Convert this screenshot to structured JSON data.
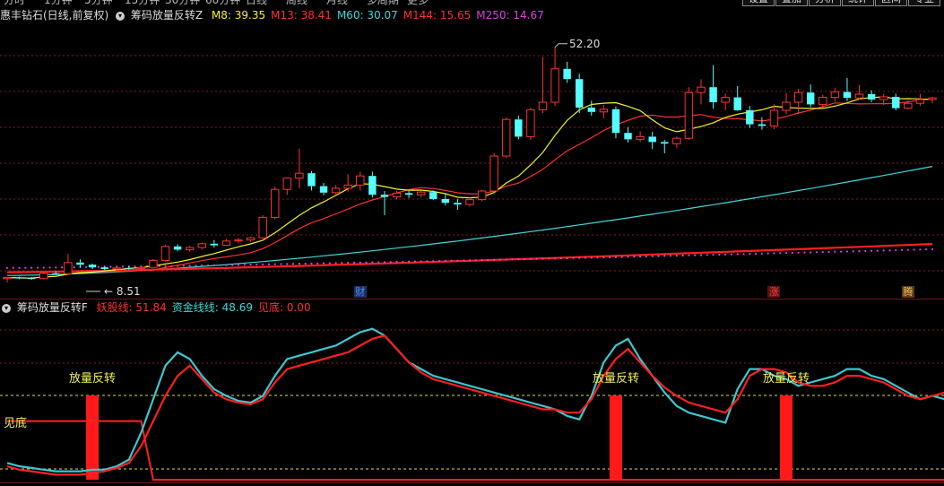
{
  "toolbar": {
    "periods": [
      "分时",
      "1分钟",
      "5分钟",
      "15分钟",
      "30分钟",
      "60分钟",
      "日线",
      "周线",
      "月线",
      "多周期",
      "更多"
    ],
    "buttons": [
      "设置",
      "叠加",
      "分析",
      "统计",
      "区间",
      "专业"
    ]
  },
  "main_panel": {
    "stock_title": "惠丰钻石(日线,前复权)",
    "indicator_name": "筹码放量反转Z",
    "ma_labels": [
      {
        "text": "M8: 39.35",
        "color": "#f3f32a"
      },
      {
        "text": "M13: 38.41",
        "color": "#ff3030"
      },
      {
        "text": "M60: 30.07",
        "color": "#3fd7d7"
      },
      {
        "text": "M144: 15.65",
        "color": "#ff3030"
      },
      {
        "text": "M250: 14.67",
        "color": "#e040e0"
      }
    ],
    "high_label": "52.20",
    "low_label": "8.51",
    "event_markers": [
      {
        "text": "财",
        "color": "#4a90e0",
        "bg": "#1d2f66"
      },
      {
        "text": "涨",
        "color": "#ff4040",
        "bg": "#5a1111"
      },
      {
        "text": "腾",
        "color": "#f0c060",
        "bg": "#5a3a10"
      }
    ]
  },
  "sub_panel": {
    "indicator_name": "筹码放量反转F",
    "labels": [
      {
        "text": "妖股线: 51.84",
        "color": "#ff3030"
      },
      {
        "text": "资金线线: 48.69",
        "color": "#3fd7d7"
      },
      {
        "text": "见底: 0.00",
        "color": "#ff3030"
      }
    ],
    "signal_text": "放量反转",
    "bottom_text": "见底"
  },
  "colors": {
    "up": "#ff3232",
    "down": "#54ffff",
    "ma8": "#f3f32a",
    "ma13": "#ff3030",
    "ma60": "#3fd7d7",
    "ma144": "#ff2020",
    "ma250": "#e040e0",
    "yaogu": "#ff2020",
    "zijin": "#3fc6cf",
    "dash_grid": "#8b1a1a",
    "dash_yellow": "#e0e040"
  },
  "chart_data": [
    {
      "type": "candlestick",
      "title": "惠丰钻石(日线,前复权)",
      "ylim": [
        8,
        56
      ],
      "candles": [
        [
          9.2,
          9.5,
          8.51,
          9.4
        ],
        [
          9.4,
          9.6,
          9.1,
          9.3
        ],
        [
          9.3,
          9.5,
          9.0,
          9.2
        ],
        [
          9.2,
          10.4,
          9.1,
          10.2
        ],
        [
          10.2,
          10.6,
          9.9,
          10.1
        ],
        [
          10.1,
          13.8,
          10.0,
          12.2
        ],
        [
          12.2,
          12.8,
          11.3,
          11.8
        ],
        [
          11.8,
          12.0,
          11.0,
          11.3
        ],
        [
          11.3,
          11.6,
          10.8,
          11.0
        ],
        [
          11.0,
          11.4,
          10.7,
          11.2
        ],
        [
          11.2,
          11.6,
          10.9,
          11.1
        ],
        [
          11.1,
          11.5,
          10.8,
          11.3
        ],
        [
          11.3,
          12.9,
          11.2,
          12.6
        ],
        [
          12.6,
          15.5,
          12.4,
          15.2
        ],
        [
          15.2,
          15.6,
          14.3,
          14.6
        ],
        [
          14.6,
          15.3,
          14.2,
          15.0
        ],
        [
          15.0,
          15.9,
          14.6,
          15.7
        ],
        [
          15.7,
          16.4,
          15.0,
          15.4
        ],
        [
          15.4,
          16.6,
          15.3,
          16.2
        ],
        [
          16.2,
          16.8,
          15.8,
          16.4
        ],
        [
          16.4,
          17.0,
          16.0,
          16.8
        ],
        [
          16.8,
          21.0,
          16.6,
          20.6
        ],
        [
          20.6,
          26.3,
          20.2,
          25.8
        ],
        [
          25.8,
          28.0,
          24.8,
          27.9
        ],
        [
          27.9,
          33.4,
          26.0,
          28.8
        ],
        [
          28.8,
          29.2,
          25.6,
          26.4
        ],
        [
          26.4,
          27.0,
          24.7,
          25.2
        ],
        [
          25.2,
          26.6,
          24.9,
          26.0
        ],
        [
          26.0,
          28.6,
          25.4,
          26.6
        ],
        [
          26.6,
          29.1,
          25.6,
          28.3
        ],
        [
          28.3,
          29.1,
          24.3,
          24.8
        ],
        [
          24.8,
          25.5,
          21.0,
          24.4
        ],
        [
          24.4,
          25.5,
          23.9,
          25.1
        ],
        [
          25.1,
          25.5,
          24.2,
          24.8
        ],
        [
          24.8,
          25.6,
          24.3,
          25.3
        ],
        [
          25.3,
          25.6,
          23.8,
          24.0
        ],
        [
          24.0,
          25.0,
          22.8,
          23.3
        ],
        [
          23.3,
          24.0,
          22.0,
          23.0
        ],
        [
          23.0,
          24.4,
          22.6,
          23.9
        ],
        [
          23.9,
          25.7,
          23.6,
          25.5
        ],
        [
          25.5,
          32.5,
          25.3,
          32.0
        ],
        [
          32.0,
          39.2,
          31.6,
          38.8
        ],
        [
          38.8,
          39.5,
          35.1,
          35.6
        ],
        [
          35.6,
          41.0,
          35.0,
          40.6
        ],
        [
          40.6,
          50.4,
          40.0,
          42.0
        ],
        [
          42.0,
          52.2,
          41.3,
          48.2
        ],
        [
          48.2,
          49.5,
          45.6,
          46.3
        ],
        [
          46.3,
          47.3,
          40.0,
          41.0
        ],
        [
          41.0,
          42.3,
          39.5,
          40.2
        ],
        [
          40.2,
          41.5,
          39.0,
          40.7
        ],
        [
          40.7,
          41.2,
          35.3,
          36.3
        ],
        [
          36.3,
          37.4,
          34.5,
          35.1
        ],
        [
          35.1,
          36.6,
          34.6,
          35.6
        ],
        [
          35.6,
          36.5,
          33.3,
          34.6
        ],
        [
          34.6,
          35.0,
          32.5,
          34.3
        ],
        [
          34.3,
          35.6,
          33.5,
          35.3
        ],
        [
          35.3,
          44.8,
          35.0,
          43.8
        ],
        [
          43.8,
          46.3,
          41.6,
          44.8
        ],
        [
          44.8,
          48.9,
          40.8,
          42.0
        ],
        [
          42.0,
          43.6,
          40.5,
          42.9
        ],
        [
          42.9,
          45.0,
          40.4,
          40.5
        ],
        [
          40.5,
          41.3,
          37.2,
          37.9
        ],
        [
          37.9,
          39.2,
          36.9,
          37.6
        ],
        [
          37.6,
          41.6,
          37.0,
          40.5
        ],
        [
          40.5,
          43.7,
          39.8,
          42.0
        ],
        [
          42.0,
          44.5,
          39.8,
          43.8
        ],
        [
          43.8,
          45.3,
          41.1,
          41.6
        ],
        [
          41.6,
          43.4,
          41.0,
          42.9
        ],
        [
          42.9,
          44.7,
          42.1,
          43.9
        ],
        [
          43.9,
          46.5,
          42.2,
          42.8
        ],
        [
          42.8,
          45.2,
          42.5,
          43.5
        ],
        [
          43.5,
          44.2,
          42.0,
          42.5
        ],
        [
          42.5,
          43.5,
          41.5,
          43.0
        ],
        [
          43.0,
          43.6,
          40.5,
          40.9
        ],
        [
          40.9,
          42.4,
          40.6,
          41.8
        ],
        [
          41.8,
          43.6,
          41.3,
          42.5
        ],
        [
          42.5,
          43.0,
          41.8,
          42.8
        ]
      ],
      "ma8_end": 39.35,
      "ma13_end": 38.41,
      "ma60_end": 30.07,
      "ma144_end": 15.65,
      "ma250_end": 14.67,
      "annotations": [
        {
          "text": "52.20"
        },
        {
          "text": "8.51"
        }
      ]
    },
    {
      "type": "line",
      "title": "筹码放量反转F",
      "ylim": [
        0,
        100
      ],
      "series": [
        {
          "name": "妖股线",
          "end": 51.84,
          "values": [
            8,
            6,
            5,
            4,
            3,
            3,
            3,
            4,
            5,
            7,
            10,
            20,
            35,
            50,
            62,
            68,
            60,
            52,
            48,
            46,
            45,
            48,
            58,
            66,
            68,
            70,
            72,
            74,
            76,
            80,
            84,
            86,
            78,
            70,
            64,
            60,
            58,
            56,
            54,
            52,
            50,
            48,
            46,
            44,
            42,
            42,
            40,
            40,
            48,
            62,
            72,
            78,
            70,
            62,
            55,
            50,
            46,
            44,
            42,
            40,
            48,
            62,
            66,
            66,
            64,
            58,
            56,
            56,
            58,
            62,
            62,
            60,
            58,
            54,
            50,
            48,
            50,
            52
          ]
        },
        {
          "name": "资金线线",
          "end": 48.69,
          "values": [
            10,
            8,
            7,
            6,
            5,
            5,
            5,
            6,
            6,
            8,
            12,
            28,
            48,
            68,
            76,
            72,
            62,
            54,
            50,
            47,
            46,
            50,
            62,
            72,
            74,
            76,
            78,
            80,
            84,
            88,
            90,
            86,
            78,
            70,
            66,
            62,
            60,
            58,
            56,
            54,
            52,
            50,
            48,
            46,
            44,
            42,
            38,
            36,
            50,
            70,
            80,
            84,
            72,
            62,
            52,
            44,
            40,
            38,
            36,
            34,
            54,
            66,
            66,
            62,
            60,
            56,
            58,
            60,
            62,
            66,
            66,
            62,
            60,
            56,
            52,
            48,
            50,
            48
          ]
        },
        {
          "name": "见底",
          "end": 0.0,
          "values": [
            35,
            35,
            35,
            35,
            35,
            35,
            35,
            35,
            35,
            35,
            35,
            35,
            0,
            0,
            0,
            0,
            0,
            0,
            0,
            0,
            0,
            0,
            0,
            0,
            0,
            0,
            0,
            0,
            0,
            0,
            0,
            0,
            0,
            0,
            0,
            0,
            0,
            0,
            0,
            0,
            0,
            0,
            0,
            0,
            0,
            0,
            0,
            0,
            0,
            0,
            0,
            0,
            0,
            0,
            0,
            0,
            0,
            0,
            0,
            0,
            0,
            0,
            0,
            0,
            0,
            0,
            0,
            0,
            0,
            0,
            0,
            0,
            0,
            0,
            0,
            0,
            0,
            0
          ]
        }
      ],
      "signals": [
        {
          "index": 7,
          "label": "放量反转"
        },
        {
          "index": 50,
          "label": "放量反转"
        },
        {
          "index": 64,
          "label": "放量反转"
        }
      ]
    }
  ]
}
